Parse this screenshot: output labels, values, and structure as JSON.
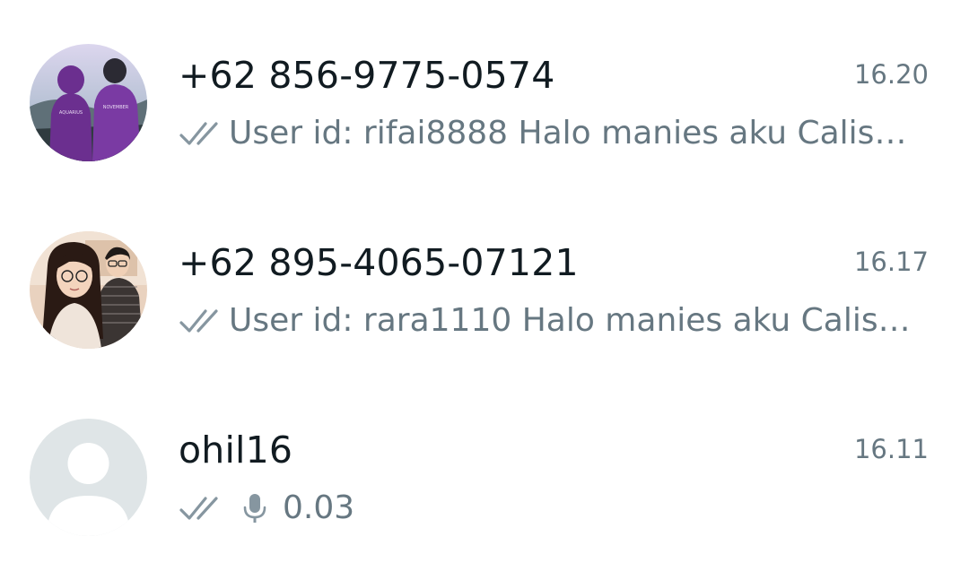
{
  "chats": [
    {
      "name": "+62 856-9775-0574",
      "time": "16.20",
      "preview": "User id: rifai8888  Halo manies aku Calis…",
      "avatar": "couple-hoodies-photo",
      "status_icon": "double-check-icon"
    },
    {
      "name": "+62 895-4065-07121",
      "time": "16.17",
      "preview": "User id: rara1110  Halo manies aku Calis…",
      "avatar": "illustrated-couple-photo",
      "status_icon": "double-check-icon"
    },
    {
      "name": "ohil16",
      "time": "16.11",
      "preview": "0.03",
      "avatar": "default-avatar",
      "status_icon": "double-check-icon",
      "preview_icon": "microphone-icon"
    }
  ],
  "colors": {
    "name": "#111b21",
    "secondary": "#667781",
    "tick": "#8696a0",
    "default_avatar_bg": "#dfe5e7"
  }
}
